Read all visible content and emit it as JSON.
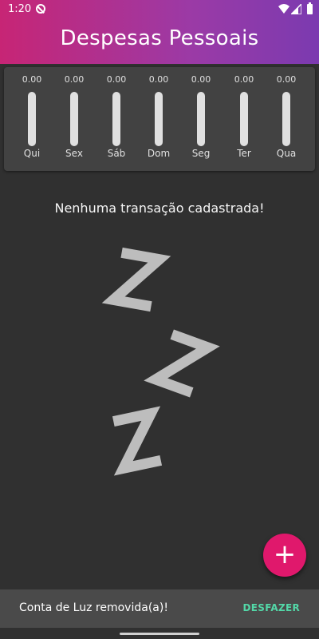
{
  "status_bar": {
    "time": "1:20",
    "icons": [
      "app-notification-icon",
      "wifi-icon",
      "signal-icon",
      "battery-icon"
    ]
  },
  "app_bar": {
    "title": "Despesas Pessoais",
    "colors": [
      "#c72575",
      "#7b3ab0"
    ]
  },
  "weekly_chart": {
    "days": [
      {
        "label": "Qui",
        "value": "0.00",
        "fraction": 0
      },
      {
        "label": "Sex",
        "value": "0.00",
        "fraction": 0
      },
      {
        "label": "Sáb",
        "value": "0.00",
        "fraction": 0
      },
      {
        "label": "Dom",
        "value": "0.00",
        "fraction": 0
      },
      {
        "label": "Seg",
        "value": "0.00",
        "fraction": 0
      },
      {
        "label": "Ter",
        "value": "0.00",
        "fraction": 0
      },
      {
        "label": "Qua",
        "value": "0.00",
        "fraction": 0
      }
    ]
  },
  "empty_state": {
    "message": "Nenhuma transação cadastrada!",
    "image": "sleeping-zzz-image"
  },
  "fab": {
    "icon": "plus-icon",
    "symbol": "+",
    "color": "#e0186c"
  },
  "snackbar": {
    "message": "Conta de Luz removida(a)!",
    "action_label": "DESFAZER",
    "action_color": "#53d8a8"
  }
}
